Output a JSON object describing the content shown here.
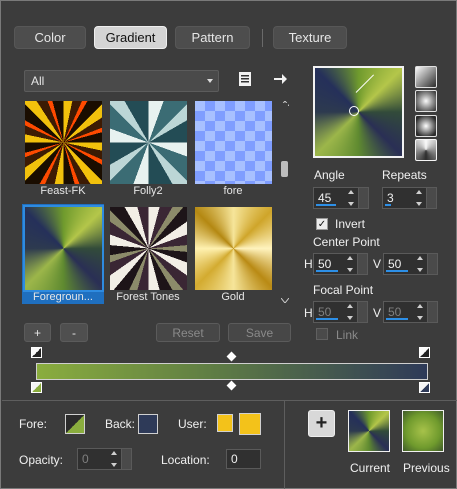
{
  "tabs": [
    {
      "label": "Color"
    },
    {
      "label": "Gradient"
    },
    {
      "label": "Pattern"
    },
    {
      "label": "Texture"
    }
  ],
  "library": {
    "category": "All",
    "items": [
      {
        "label": "Feast-FK"
      },
      {
        "label": "Folly2"
      },
      {
        "label": "fore"
      },
      {
        "label": "Foregroun..."
      },
      {
        "label": "Forest Tones"
      },
      {
        "label": "Gold"
      }
    ],
    "add_label": "+",
    "remove_label": "-",
    "reset_label": "Reset",
    "save_label": "Save"
  },
  "settings": {
    "angle_label": "Angle",
    "angle_value": "45",
    "repeats_label": "Repeats",
    "repeats_value": "3",
    "invert_label": "Invert",
    "invert_checked": true,
    "center_point_label": "Center Point",
    "center_h_label": "H",
    "center_h_value": "50",
    "center_v_label": "V",
    "center_v_value": "50",
    "focal_point_label": "Focal Point",
    "focal_h_label": "H",
    "focal_h_value": "50",
    "focal_v_label": "V",
    "focal_v_value": "50",
    "link_label": "Link"
  },
  "stops": {
    "fore_label": "Fore:",
    "back_label": "Back:",
    "user_label": "User:",
    "opacity_label": "Opacity:",
    "opacity_value": "0",
    "location_label": "Location:",
    "location_value": "0"
  },
  "compare": {
    "add_label": "+",
    "current_label": "Current",
    "previous_label": "Previous"
  },
  "colors": {
    "accent": "#1f6fbf",
    "fore": "#8aad3e",
    "back": "#2e3a58",
    "user": "#f3c21a"
  }
}
